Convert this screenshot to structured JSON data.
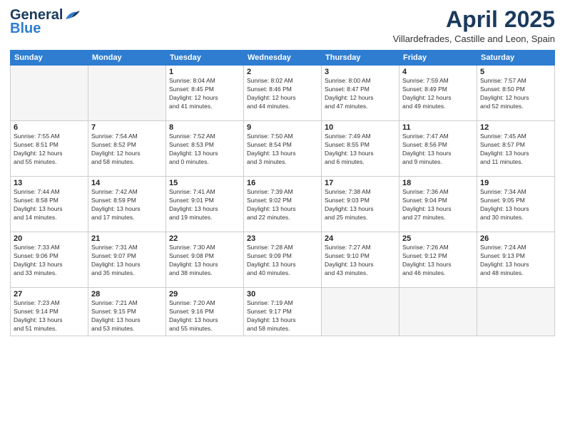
{
  "header": {
    "logo_line1": "General",
    "logo_line2": "Blue",
    "month": "April 2025",
    "location": "Villardefrades, Castille and Leon, Spain"
  },
  "days_of_week": [
    "Sunday",
    "Monday",
    "Tuesday",
    "Wednesday",
    "Thursday",
    "Friday",
    "Saturday"
  ],
  "weeks": [
    [
      {
        "day": "",
        "info": ""
      },
      {
        "day": "",
        "info": ""
      },
      {
        "day": "1",
        "info": "Sunrise: 8:04 AM\nSunset: 8:45 PM\nDaylight: 12 hours\nand 41 minutes."
      },
      {
        "day": "2",
        "info": "Sunrise: 8:02 AM\nSunset: 8:46 PM\nDaylight: 12 hours\nand 44 minutes."
      },
      {
        "day": "3",
        "info": "Sunrise: 8:00 AM\nSunset: 8:47 PM\nDaylight: 12 hours\nand 47 minutes."
      },
      {
        "day": "4",
        "info": "Sunrise: 7:59 AM\nSunset: 8:49 PM\nDaylight: 12 hours\nand 49 minutes."
      },
      {
        "day": "5",
        "info": "Sunrise: 7:57 AM\nSunset: 8:50 PM\nDaylight: 12 hours\nand 52 minutes."
      }
    ],
    [
      {
        "day": "6",
        "info": "Sunrise: 7:55 AM\nSunset: 8:51 PM\nDaylight: 12 hours\nand 55 minutes."
      },
      {
        "day": "7",
        "info": "Sunrise: 7:54 AM\nSunset: 8:52 PM\nDaylight: 12 hours\nand 58 minutes."
      },
      {
        "day": "8",
        "info": "Sunrise: 7:52 AM\nSunset: 8:53 PM\nDaylight: 13 hours\nand 0 minutes."
      },
      {
        "day": "9",
        "info": "Sunrise: 7:50 AM\nSunset: 8:54 PM\nDaylight: 13 hours\nand 3 minutes."
      },
      {
        "day": "10",
        "info": "Sunrise: 7:49 AM\nSunset: 8:55 PM\nDaylight: 13 hours\nand 6 minutes."
      },
      {
        "day": "11",
        "info": "Sunrise: 7:47 AM\nSunset: 8:56 PM\nDaylight: 13 hours\nand 9 minutes."
      },
      {
        "day": "12",
        "info": "Sunrise: 7:45 AM\nSunset: 8:57 PM\nDaylight: 13 hours\nand 11 minutes."
      }
    ],
    [
      {
        "day": "13",
        "info": "Sunrise: 7:44 AM\nSunset: 8:58 PM\nDaylight: 13 hours\nand 14 minutes."
      },
      {
        "day": "14",
        "info": "Sunrise: 7:42 AM\nSunset: 8:59 PM\nDaylight: 13 hours\nand 17 minutes."
      },
      {
        "day": "15",
        "info": "Sunrise: 7:41 AM\nSunset: 9:01 PM\nDaylight: 13 hours\nand 19 minutes."
      },
      {
        "day": "16",
        "info": "Sunrise: 7:39 AM\nSunset: 9:02 PM\nDaylight: 13 hours\nand 22 minutes."
      },
      {
        "day": "17",
        "info": "Sunrise: 7:38 AM\nSunset: 9:03 PM\nDaylight: 13 hours\nand 25 minutes."
      },
      {
        "day": "18",
        "info": "Sunrise: 7:36 AM\nSunset: 9:04 PM\nDaylight: 13 hours\nand 27 minutes."
      },
      {
        "day": "19",
        "info": "Sunrise: 7:34 AM\nSunset: 9:05 PM\nDaylight: 13 hours\nand 30 minutes."
      }
    ],
    [
      {
        "day": "20",
        "info": "Sunrise: 7:33 AM\nSunset: 9:06 PM\nDaylight: 13 hours\nand 33 minutes."
      },
      {
        "day": "21",
        "info": "Sunrise: 7:31 AM\nSunset: 9:07 PM\nDaylight: 13 hours\nand 35 minutes."
      },
      {
        "day": "22",
        "info": "Sunrise: 7:30 AM\nSunset: 9:08 PM\nDaylight: 13 hours\nand 38 minutes."
      },
      {
        "day": "23",
        "info": "Sunrise: 7:28 AM\nSunset: 9:09 PM\nDaylight: 13 hours\nand 40 minutes."
      },
      {
        "day": "24",
        "info": "Sunrise: 7:27 AM\nSunset: 9:10 PM\nDaylight: 13 hours\nand 43 minutes."
      },
      {
        "day": "25",
        "info": "Sunrise: 7:26 AM\nSunset: 9:12 PM\nDaylight: 13 hours\nand 46 minutes."
      },
      {
        "day": "26",
        "info": "Sunrise: 7:24 AM\nSunset: 9:13 PM\nDaylight: 13 hours\nand 48 minutes."
      }
    ],
    [
      {
        "day": "27",
        "info": "Sunrise: 7:23 AM\nSunset: 9:14 PM\nDaylight: 13 hours\nand 51 minutes."
      },
      {
        "day": "28",
        "info": "Sunrise: 7:21 AM\nSunset: 9:15 PM\nDaylight: 13 hours\nand 53 minutes."
      },
      {
        "day": "29",
        "info": "Sunrise: 7:20 AM\nSunset: 9:16 PM\nDaylight: 13 hours\nand 55 minutes."
      },
      {
        "day": "30",
        "info": "Sunrise: 7:19 AM\nSunset: 9:17 PM\nDaylight: 13 hours\nand 58 minutes."
      },
      {
        "day": "",
        "info": ""
      },
      {
        "day": "",
        "info": ""
      },
      {
        "day": "",
        "info": ""
      }
    ]
  ]
}
